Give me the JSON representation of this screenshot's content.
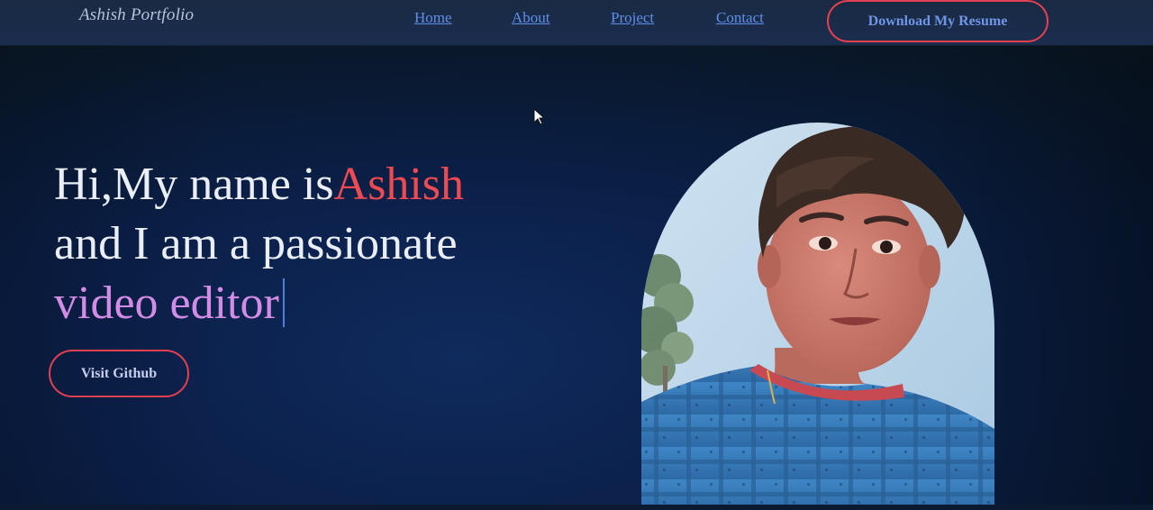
{
  "navbar": {
    "brand": "Ashish Portfolio",
    "links": [
      {
        "label": "Home"
      },
      {
        "label": "About"
      },
      {
        "label": "Project"
      },
      {
        "label": "Contact"
      }
    ],
    "resume_button": "Download My Resume"
  },
  "hero": {
    "greeting": "Hi,My name is",
    "name": "Ashish",
    "line2": "and I am a passionate",
    "role": "video editor",
    "github_button": "Visit Github"
  },
  "colors": {
    "accent_red": "#e4404f",
    "name_red": "#ee4a52",
    "role_purple": "#d38ce6",
    "link_blue": "#5f8fe8",
    "background_navy": "#0b1f48"
  },
  "icons": {
    "mouse_cursor": "arrow-pointer"
  }
}
